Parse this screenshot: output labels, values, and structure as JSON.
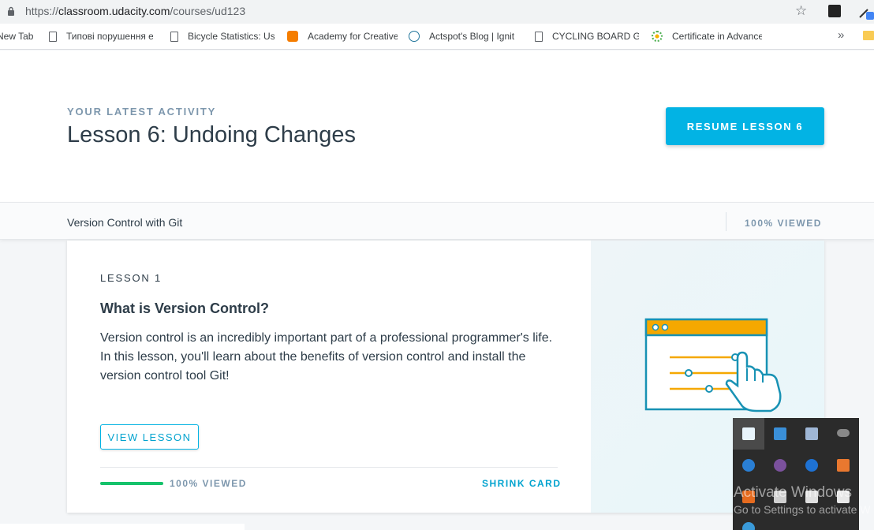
{
  "browser": {
    "url_scheme": "https://",
    "url_host": "classroom.udacity.com",
    "url_path": "/courses/ud123",
    "bookmarks": [
      {
        "label": "New Tab",
        "icon": "none"
      },
      {
        "label": "Типові порушення е",
        "icon": "doc-icon"
      },
      {
        "label": "Bicycle Statistics: Usa",
        "icon": "doc-icon"
      },
      {
        "label": "Academy for Creative",
        "icon": "blogger-icon"
      },
      {
        "label": "Actspot's Blog | Ignit",
        "icon": "wordpress-icon"
      },
      {
        "label": "CYCLING BOARD GAI",
        "icon": "doc-icon"
      },
      {
        "label": "Certificate in Advance",
        "icon": "sun-icon"
      }
    ],
    "more_label": "»"
  },
  "activity": {
    "eyebrow": "YOUR LATEST ACTIVITY",
    "title": "Lesson 6: Undoing Changes",
    "resume_label": "RESUME LESSON 6"
  },
  "course": {
    "name": "Version Control with Git",
    "viewed": "100% VIEWED"
  },
  "card": {
    "lesson_number": "LESSON 1",
    "heading": "What is Version Control?",
    "description": "Version control is an incredibly important part of a professional programmer's life. In this lesson, you'll learn about the benefits of version control and install the version control tool Git!",
    "view_label": "VIEW LESSON",
    "progress_percent": 100,
    "viewed": "100% VIEWED",
    "shrink_label": "SHRINK CARD"
  },
  "tray": {
    "watermark_title": "Activate Windows",
    "watermark_sub": "Go to Settings to activate W"
  },
  "colors": {
    "accent": "#02b3e4",
    "progress": "#15c26b",
    "illustration_orange": "#f5a800",
    "illustration_blue": "#1892b4"
  }
}
